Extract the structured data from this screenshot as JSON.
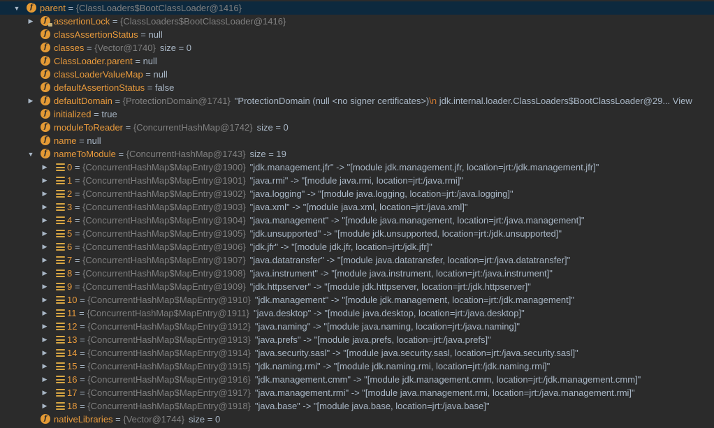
{
  "tree": [
    {
      "id": "parent",
      "indent": 0,
      "arrow": "expanded",
      "icon": "field",
      "name": "parent",
      "eq": " = ",
      "ref": "{ClassLoaders$BootClassLoader@1416}",
      "tail": "",
      "selected": true
    },
    {
      "id": "assertionLock",
      "indent": 1,
      "arrow": "collapsed",
      "icon": "field",
      "lock": true,
      "name": "assertionLock",
      "eq": " = ",
      "ref": "{ClassLoaders$BootClassLoader@1416}",
      "tail": ""
    },
    {
      "id": "classAssertionStatus",
      "indent": 1,
      "arrow": "none",
      "icon": "field",
      "name": "classAssertionStatus",
      "eq": " = ",
      "ref": "",
      "tail": "null"
    },
    {
      "id": "classes",
      "indent": 1,
      "arrow": "none",
      "icon": "field",
      "name": "classes",
      "eq": " = ",
      "ref": "{Vector@1740}",
      "tail": "size = 0"
    },
    {
      "id": "classloader-parent",
      "indent": 1,
      "arrow": "none",
      "icon": "field",
      "name": "ClassLoader.parent",
      "eq": " = ",
      "ref": "",
      "tail": "null"
    },
    {
      "id": "classLoaderValueMap",
      "indent": 1,
      "arrow": "none",
      "icon": "field",
      "name": "classLoaderValueMap",
      "eq": " = ",
      "ref": "",
      "tail": "null"
    },
    {
      "id": "defaultAssertionStatus",
      "indent": 1,
      "arrow": "none",
      "icon": "field",
      "name": "defaultAssertionStatus",
      "eq": " = ",
      "ref": "",
      "tail": "false"
    },
    {
      "id": "defaultDomain",
      "indent": 1,
      "arrow": "collapsed",
      "icon": "field",
      "name": "defaultDomain",
      "eq": " = ",
      "ref": "{ProtectionDomain@1741}",
      "tail": "\"ProtectionDomain  (null <no signer certificates>)",
      "esc": "\\n",
      "tail2": " jdk.internal.loader.ClassLoaders$BootClassLoader@29... View"
    },
    {
      "id": "initialized",
      "indent": 1,
      "arrow": "none",
      "icon": "field",
      "name": "initialized",
      "eq": " = ",
      "ref": "",
      "tail": "true"
    },
    {
      "id": "moduleToReader",
      "indent": 1,
      "arrow": "none",
      "icon": "field",
      "name": "moduleToReader",
      "eq": " = ",
      "ref": "{ConcurrentHashMap@1742}",
      "tail": "size = 0"
    },
    {
      "id": "name",
      "indent": 1,
      "arrow": "none",
      "icon": "field",
      "name": "name",
      "eq": " = ",
      "ref": "",
      "tail": "null"
    },
    {
      "id": "nameToModule",
      "indent": 1,
      "arrow": "expanded",
      "icon": "field",
      "name": "nameToModule",
      "eq": " = ",
      "ref": "{ConcurrentHashMap@1743}",
      "tail": "size = 19"
    },
    {
      "id": "entry-0",
      "indent": 2,
      "arrow": "collapsed",
      "icon": "entry",
      "name": "0",
      "eq": " = ",
      "ref": "{ConcurrentHashMap$MapEntry@1900}",
      "tail": "\"jdk.management.jfr\" -> \"[module jdk.management.jfr, location=jrt:/jdk.management.jfr]\""
    },
    {
      "id": "entry-1",
      "indent": 2,
      "arrow": "collapsed",
      "icon": "entry",
      "name": "1",
      "eq": " = ",
      "ref": "{ConcurrentHashMap$MapEntry@1901}",
      "tail": "\"java.rmi\" -> \"[module java.rmi, location=jrt:/java.rmi]\""
    },
    {
      "id": "entry-2",
      "indent": 2,
      "arrow": "collapsed",
      "icon": "entry",
      "name": "2",
      "eq": " = ",
      "ref": "{ConcurrentHashMap$MapEntry@1902}",
      "tail": "\"java.logging\" -> \"[module java.logging, location=jrt:/java.logging]\""
    },
    {
      "id": "entry-3",
      "indent": 2,
      "arrow": "collapsed",
      "icon": "entry",
      "name": "3",
      "eq": " = ",
      "ref": "{ConcurrentHashMap$MapEntry@1903}",
      "tail": "\"java.xml\" -> \"[module java.xml, location=jrt:/java.xml]\""
    },
    {
      "id": "entry-4",
      "indent": 2,
      "arrow": "collapsed",
      "icon": "entry",
      "name": "4",
      "eq": " = ",
      "ref": "{ConcurrentHashMap$MapEntry@1904}",
      "tail": "\"java.management\" -> \"[module java.management, location=jrt:/java.management]\""
    },
    {
      "id": "entry-5",
      "indent": 2,
      "arrow": "collapsed",
      "icon": "entry",
      "name": "5",
      "eq": " = ",
      "ref": "{ConcurrentHashMap$MapEntry@1905}",
      "tail": "\"jdk.unsupported\" -> \"[module jdk.unsupported, location=jrt:/jdk.unsupported]\""
    },
    {
      "id": "entry-6",
      "indent": 2,
      "arrow": "collapsed",
      "icon": "entry",
      "name": "6",
      "eq": " = ",
      "ref": "{ConcurrentHashMap$MapEntry@1906}",
      "tail": "\"jdk.jfr\" -> \"[module jdk.jfr, location=jrt:/jdk.jfr]\""
    },
    {
      "id": "entry-7",
      "indent": 2,
      "arrow": "collapsed",
      "icon": "entry",
      "name": "7",
      "eq": " = ",
      "ref": "{ConcurrentHashMap$MapEntry@1907}",
      "tail": "\"java.datatransfer\" -> \"[module java.datatransfer, location=jrt:/java.datatransfer]\""
    },
    {
      "id": "entry-8",
      "indent": 2,
      "arrow": "collapsed",
      "icon": "entry",
      "name": "8",
      "eq": " = ",
      "ref": "{ConcurrentHashMap$MapEntry@1908}",
      "tail": "\"java.instrument\" -> \"[module java.instrument, location=jrt:/java.instrument]\""
    },
    {
      "id": "entry-9",
      "indent": 2,
      "arrow": "collapsed",
      "icon": "entry",
      "name": "9",
      "eq": " = ",
      "ref": "{ConcurrentHashMap$MapEntry@1909}",
      "tail": "\"jdk.httpserver\" -> \"[module jdk.httpserver, location=jrt:/jdk.httpserver]\""
    },
    {
      "id": "entry-10",
      "indent": 2,
      "arrow": "collapsed",
      "icon": "entry",
      "name": "10",
      "eq": " = ",
      "ref": "{ConcurrentHashMap$MapEntry@1910}",
      "tail": "\"jdk.management\" -> \"[module jdk.management, location=jrt:/jdk.management]\""
    },
    {
      "id": "entry-11",
      "indent": 2,
      "arrow": "collapsed",
      "icon": "entry",
      "name": "11",
      "eq": " = ",
      "ref": "{ConcurrentHashMap$MapEntry@1911}",
      "tail": "\"java.desktop\" -> \"[module java.desktop, location=jrt:/java.desktop]\""
    },
    {
      "id": "entry-12",
      "indent": 2,
      "arrow": "collapsed",
      "icon": "entry",
      "name": "12",
      "eq": " = ",
      "ref": "{ConcurrentHashMap$MapEntry@1912}",
      "tail": "\"java.naming\" -> \"[module java.naming, location=jrt:/java.naming]\""
    },
    {
      "id": "entry-13",
      "indent": 2,
      "arrow": "collapsed",
      "icon": "entry",
      "name": "13",
      "eq": " = ",
      "ref": "{ConcurrentHashMap$MapEntry@1913}",
      "tail": "\"java.prefs\" -> \"[module java.prefs, location=jrt:/java.prefs]\""
    },
    {
      "id": "entry-14",
      "indent": 2,
      "arrow": "collapsed",
      "icon": "entry",
      "name": "14",
      "eq": " = ",
      "ref": "{ConcurrentHashMap$MapEntry@1914}",
      "tail": "\"java.security.sasl\" -> \"[module java.security.sasl, location=jrt:/java.security.sasl]\""
    },
    {
      "id": "entry-15",
      "indent": 2,
      "arrow": "collapsed",
      "icon": "entry",
      "name": "15",
      "eq": " = ",
      "ref": "{ConcurrentHashMap$MapEntry@1915}",
      "tail": "\"jdk.naming.rmi\" -> \"[module jdk.naming.rmi, location=jrt:/jdk.naming.rmi]\""
    },
    {
      "id": "entry-16",
      "indent": 2,
      "arrow": "collapsed",
      "icon": "entry",
      "name": "16",
      "eq": " = ",
      "ref": "{ConcurrentHashMap$MapEntry@1916}",
      "tail": "\"jdk.management.cmm\" -> \"[module jdk.management.cmm, location=jrt:/jdk.management.cmm]\""
    },
    {
      "id": "entry-17",
      "indent": 2,
      "arrow": "collapsed",
      "icon": "entry",
      "name": "17",
      "eq": " = ",
      "ref": "{ConcurrentHashMap$MapEntry@1917}",
      "tail": "\"java.management.rmi\" -> \"[module java.management.rmi, location=jrt:/java.management.rmi]\""
    },
    {
      "id": "entry-18",
      "indent": 2,
      "arrow": "collapsed",
      "icon": "entry",
      "name": "18",
      "eq": " = ",
      "ref": "{ConcurrentHashMap$MapEntry@1918}",
      "tail": "\"java.base\" -> \"[module java.base, location=jrt:/java.base]\""
    },
    {
      "id": "nativeLibraries",
      "indent": 1,
      "arrow": "none",
      "icon": "field",
      "name": "nativeLibraries",
      "eq": " = ",
      "ref": "{Vector@1744}",
      "tail": "size = 0"
    }
  ],
  "colors": {
    "background": "#2b2b2b",
    "selection": "#0d293e",
    "field_name": "#e89a3c",
    "reference": "#808080",
    "value": "#a9b7c6",
    "field_icon": "#e49a35",
    "entry_icon": "#d9a744"
  },
  "icons": {
    "field": "field-icon",
    "entry": "map-entry-icon",
    "expanded": "triangle-down-icon",
    "collapsed": "triangle-right-icon"
  }
}
